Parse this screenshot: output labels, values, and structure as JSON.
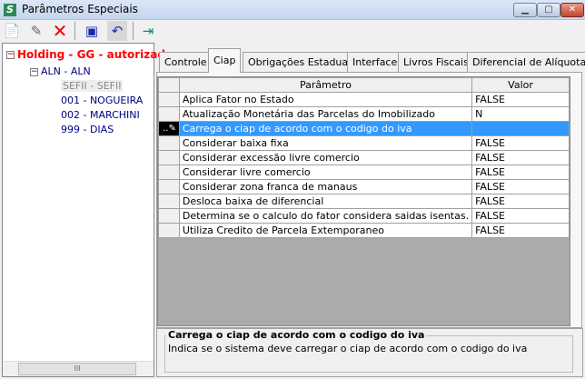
{
  "window": {
    "title": "Parâmetros Especiais",
    "icon": "S",
    "controls": [
      "minimize",
      "maximize",
      "close"
    ]
  },
  "toolbar": [
    "new-icon",
    "edit-icon",
    "delete-icon",
    "save-icon",
    "undo-icon",
    "exit-icon"
  ],
  "tree": {
    "root": "Holding -  GG -  autorizada",
    "child": "ALN - ALN",
    "leaves": [
      "SEFII - SEFII",
      "001 - NOGUEIRA",
      "002 - MARCHINI",
      "999 - DIAS"
    ],
    "scroll_glyph": "III"
  },
  "tabs": [
    "Controle",
    "Ciap",
    "Obrigações Estaduais",
    "Interface",
    "Livros Fiscais",
    "Diferencial de Alíquota"
  ],
  "active_tab": "Ciap",
  "grid": {
    "headers": [
      "Parâmetro",
      "Valor"
    ],
    "rows": [
      {
        "p": "Aplica Fator no Estado",
        "v": "FALSE"
      },
      {
        "p": "Atualização Monetária das Parcelas do Imobilizado",
        "v": "N"
      },
      {
        "p": "Carrega o ciap de acordo com o codigo do iva",
        "v": ""
      },
      {
        "p": "Considerar baixa fixa",
        "v": "FALSE"
      },
      {
        "p": "Considerar excessão livre comercio",
        "v": "FALSE"
      },
      {
        "p": "Considerar livre comercio",
        "v": "FALSE"
      },
      {
        "p": "Considerar zona franca de manaus",
        "v": "FALSE"
      },
      {
        "p": "Desloca baixa de diferencial",
        "v": "FALSE"
      },
      {
        "p": "Determina se o calculo do fator considera saidas isentas.",
        "v": "FALSE"
      },
      {
        "p": "Utiliza Credito de Parcela Extemporaneo",
        "v": "FALSE"
      }
    ],
    "selected_index": 2,
    "edit_glyph": "..✎"
  },
  "description": {
    "title": "Carrega o ciap de acordo com o codigo do iva",
    "text": "Indica se o sistema deve carregar o ciap de acordo com o codigo do iva"
  }
}
